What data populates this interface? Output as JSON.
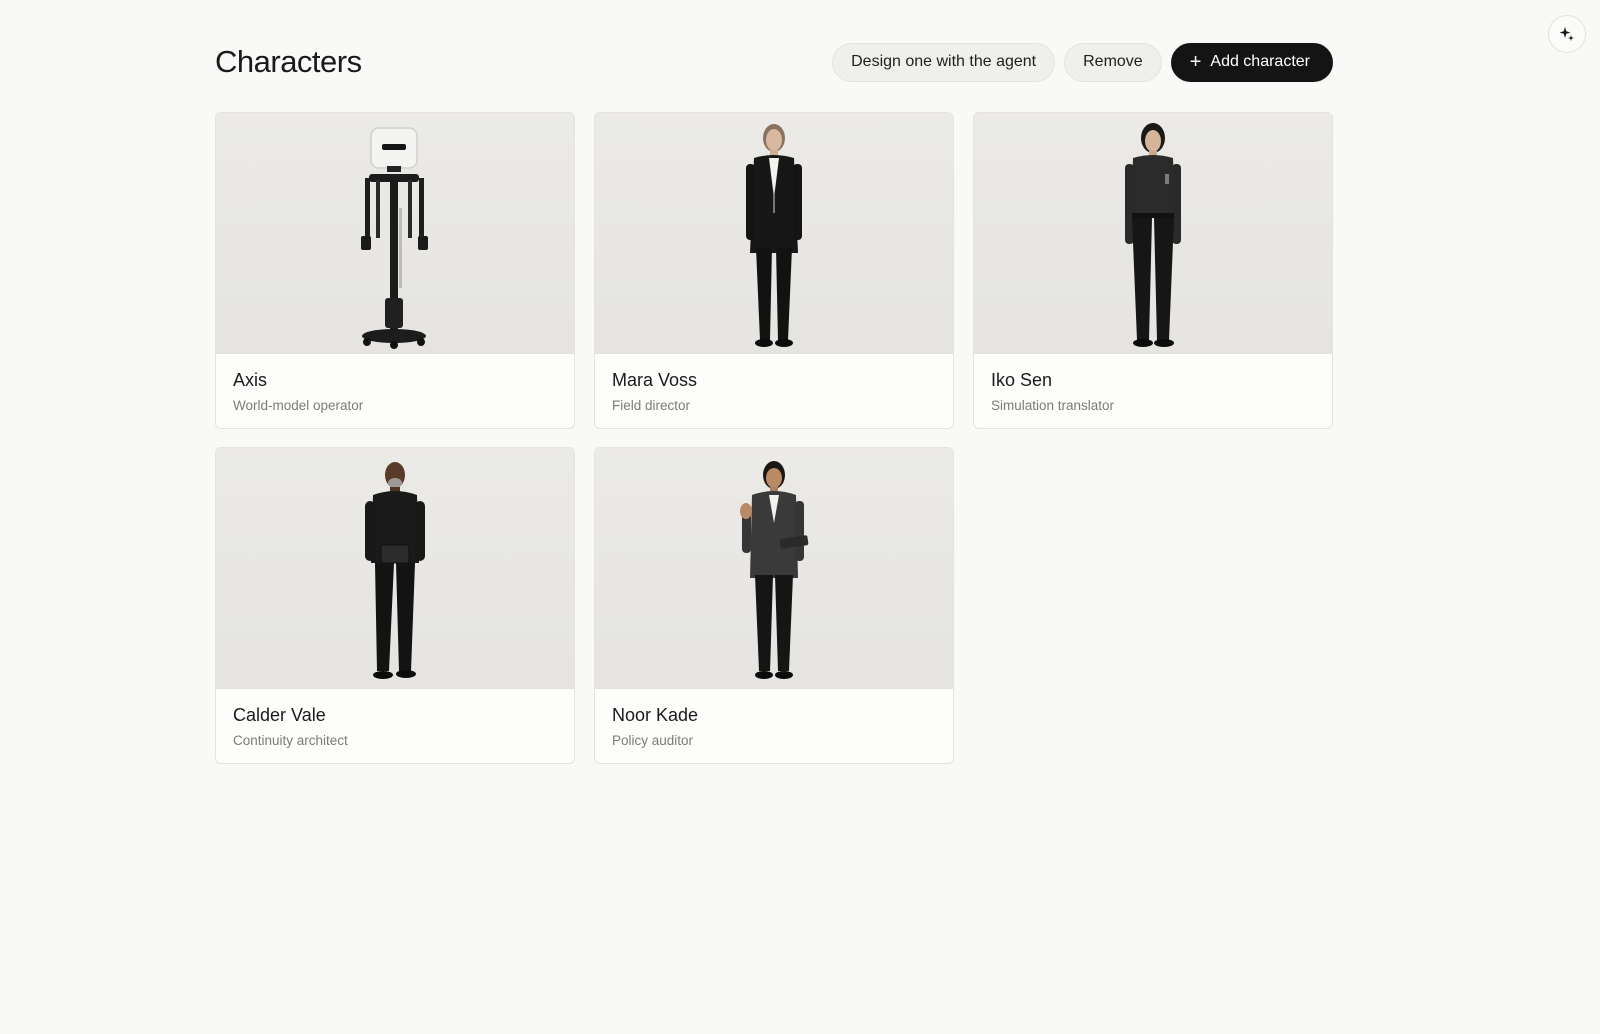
{
  "header": {
    "title": "Characters",
    "design_button_label": "Design one with the agent",
    "remove_button_label": "Remove",
    "add_button_label": "Add character",
    "add_button_icon": "plus-icon"
  },
  "agent_button": {
    "icon": "sparkle-icon"
  },
  "characters": [
    {
      "name": "Axis",
      "role": "World-model operator",
      "portrait": "robot-portrait"
    },
    {
      "name": "Mara Voss",
      "role": "Field director",
      "portrait": "person-portrait"
    },
    {
      "name": "Iko Sen",
      "role": "Simulation translator",
      "portrait": "person-portrait"
    },
    {
      "name": "Calder Vale",
      "role": "Continuity architect",
      "portrait": "person-portrait"
    },
    {
      "name": "Noor Kade",
      "role": "Policy auditor",
      "portrait": "person-portrait"
    }
  ],
  "colors": {
    "background": "#f9f9f7",
    "primary_button": "#141414",
    "secondary_button": "#efefec",
    "muted_text": "#7b7b78"
  }
}
